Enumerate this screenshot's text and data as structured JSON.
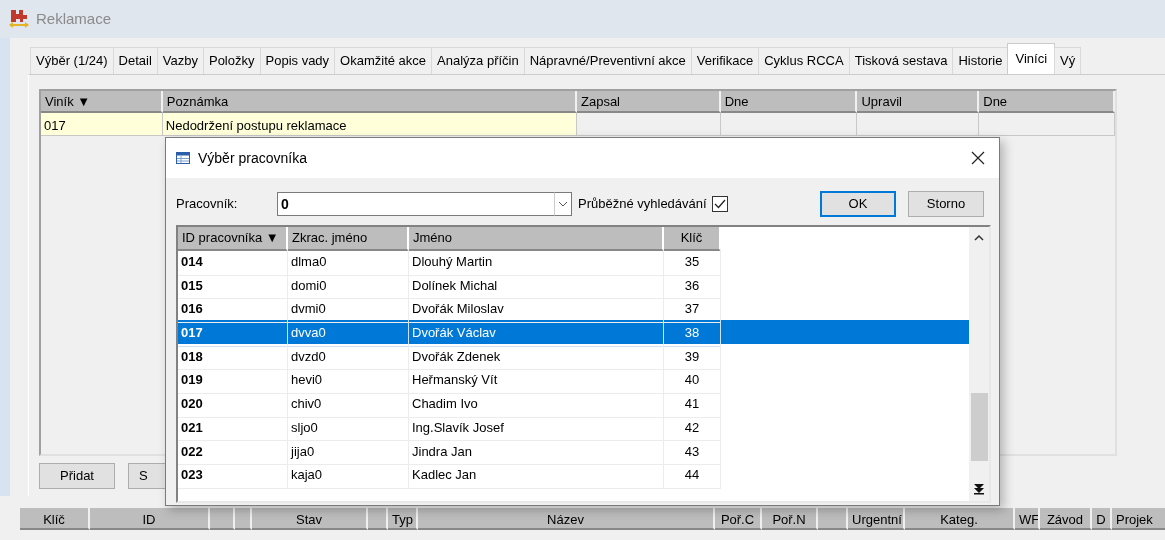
{
  "window": {
    "title": "Reklamace"
  },
  "tabs": [
    {
      "label": "Výběr (1/24)",
      "selected": false
    },
    {
      "label": "Detail",
      "selected": false
    },
    {
      "label": "Vazby",
      "selected": false
    },
    {
      "label": "Položky",
      "selected": false
    },
    {
      "label": "Popis vady",
      "selected": false
    },
    {
      "label": "Okamžité akce",
      "selected": false
    },
    {
      "label": "Analýza příčin",
      "selected": false
    },
    {
      "label": "Nápravné/Preventivní akce",
      "selected": false
    },
    {
      "label": "Verifikace",
      "selected": false
    },
    {
      "label": "Cyklus RCCA",
      "selected": false
    },
    {
      "label": "Tisková sestava",
      "selected": false
    },
    {
      "label": "Historie",
      "selected": false
    },
    {
      "label": "Viníci",
      "selected": true
    },
    {
      "label": "Vý",
      "selected": false
    }
  ],
  "culprits_table": {
    "columns": [
      "Viník ▼",
      "Poznámka",
      "Zapsal",
      "Dne",
      "Upravil",
      "Dne"
    ],
    "rows": [
      {
        "culprit": "017",
        "note": "Nedodržení postupu reklamace"
      }
    ]
  },
  "panel_buttons": [
    "Přidat",
    "S"
  ],
  "dialog": {
    "title": "Výběr pracovníka",
    "employee_label": "Pracovník:",
    "employee_value": "0",
    "live_search": {
      "label": "Průběžné vyhledávání",
      "checked": true
    },
    "buttons": [
      "OK",
      "Storno"
    ],
    "grid": {
      "columns": [
        "ID pracovníka ▼",
        "Zkrac. jméno",
        "Jméno",
        "Klíč"
      ],
      "rows": [
        {
          "id": "014",
          "short": "dlma0",
          "name": "Dlouhý Martin",
          "key": "35",
          "selected": false
        },
        {
          "id": "015",
          "short": "domi0",
          "name": "Dolínek Michal",
          "key": "36",
          "selected": false
        },
        {
          "id": "016",
          "short": "dvmi0",
          "name": "Dvořák Miloslav",
          "key": "37",
          "selected": false
        },
        {
          "id": "017",
          "short": "dvva0",
          "name": "Dvořák Václav",
          "key": "38",
          "selected": true
        },
        {
          "id": "018",
          "short": "dvzd0",
          "name": "Dvořák Zdenek",
          "key": "39",
          "selected": false
        },
        {
          "id": "019",
          "short": "hevi0",
          "name": "Heřmanský Vít",
          "key": "40",
          "selected": false
        },
        {
          "id": "020",
          "short": "chiv0",
          "name": "Chadim Ivo",
          "key": "41",
          "selected": false
        },
        {
          "id": "021",
          "short": "sljo0",
          "name": "Ing.Slavík Josef",
          "key": "42",
          "selected": false
        },
        {
          "id": "022",
          "short": "jija0",
          "name": "Jindra Jan",
          "key": "43",
          "selected": false
        },
        {
          "id": "023",
          "short": "kaja0",
          "name": "Kadlec Jan",
          "key": "44",
          "selected": false
        }
      ]
    }
  },
  "lower_table": {
    "columns": [
      "Klíč",
      "ID",
      "Stav",
      "Typ",
      "Název",
      "Poř.C",
      "Poř.N",
      "Urgentní",
      "Kateg.",
      "WF",
      "Závod",
      "D",
      "Projek"
    ]
  }
}
